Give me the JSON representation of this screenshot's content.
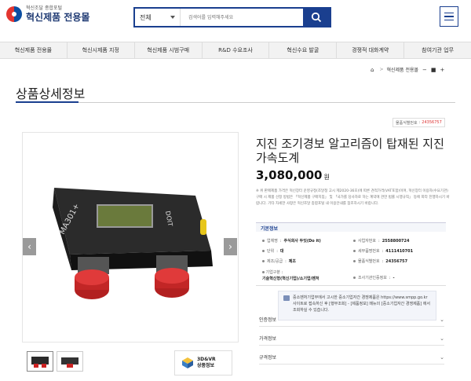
{
  "header": {
    "logo_sub": "혁신조달 종합포털",
    "logo_title": "혁신제품 전용몰",
    "search_category": "전체",
    "search_placeholder": "검색어를 입력해주세요"
  },
  "nav": [
    "혁신제품 전용몰",
    "혁신시제품 지정",
    "혁신제품 시범구매",
    "R&D 수요조사",
    "혁신수요 발굴",
    "경쟁적 대화계약",
    "참여기관 업무"
  ],
  "breadcrumb": {
    "current": "혁신제품 전용몰"
  },
  "page_title": "상품상세정보",
  "product": {
    "reg_label": "물품식별번호",
    "reg_value": "24356757",
    "title": "지진 조기경보 알고리즘이 탑재된 지진가속도계",
    "price": "3,080,000",
    "price_unit": "원",
    "notice": "※ 위 판매제품 가격은 혁신장터 운영규정(조달청 고시 제2020-36호)에 따른 견적가격(VAT포함)이며, 혁신장터 이용자(수요기관) 구매 시 제품 선정 방법은 「혁신제품 구매지침」 및 「국가를 당사자로 하는 계약에 관한 법률 시행규칙」 등에 따라 진행하시기 바랍니다. 기타 자세한 사항은 혁신조달 종합포털 내 이용안내를 참조하시기 바랍니다."
  },
  "basic_info": {
    "heading": "기본정보",
    "specs": {
      "maker_k": "업체명",
      "maker_v": "주식회사 두잇(Do it)",
      "bizno_k": "사업자번호",
      "bizno_v": "2558800724",
      "unit_k": "단위",
      "unit_v": "대",
      "detail_k": "세부품명번호",
      "detail_v": "4111410701",
      "origin_k": "제조/공급",
      "origin_v": "제조",
      "ident_k": "물품식별번호",
      "ident_v": "24356757",
      "type_k": "기업구분",
      "type_v": "기술혁신형(혁신기업)/소기업/벤처",
      "cert_k": "조사기관인증정보",
      "cert_v": "-"
    }
  },
  "info_box": "중소벤처기업부에서 고시한 중소기업자간 경쟁제품은 https://www.smpp.go.kr 사이트로 접속하신 후 [행부조회] - [제품정보] 메뉴의 [중소기업자간 경쟁제품] 에서 조회하실 수 있습니다.",
  "accordions": [
    "인증정보",
    "가격정보",
    "규격정보"
  ],
  "media": {
    "threed_line1": "3D&VR",
    "threed_line2": "상품정보"
  },
  "colors": {
    "primary": "#1a3f8f",
    "price_red": "#d33333"
  }
}
